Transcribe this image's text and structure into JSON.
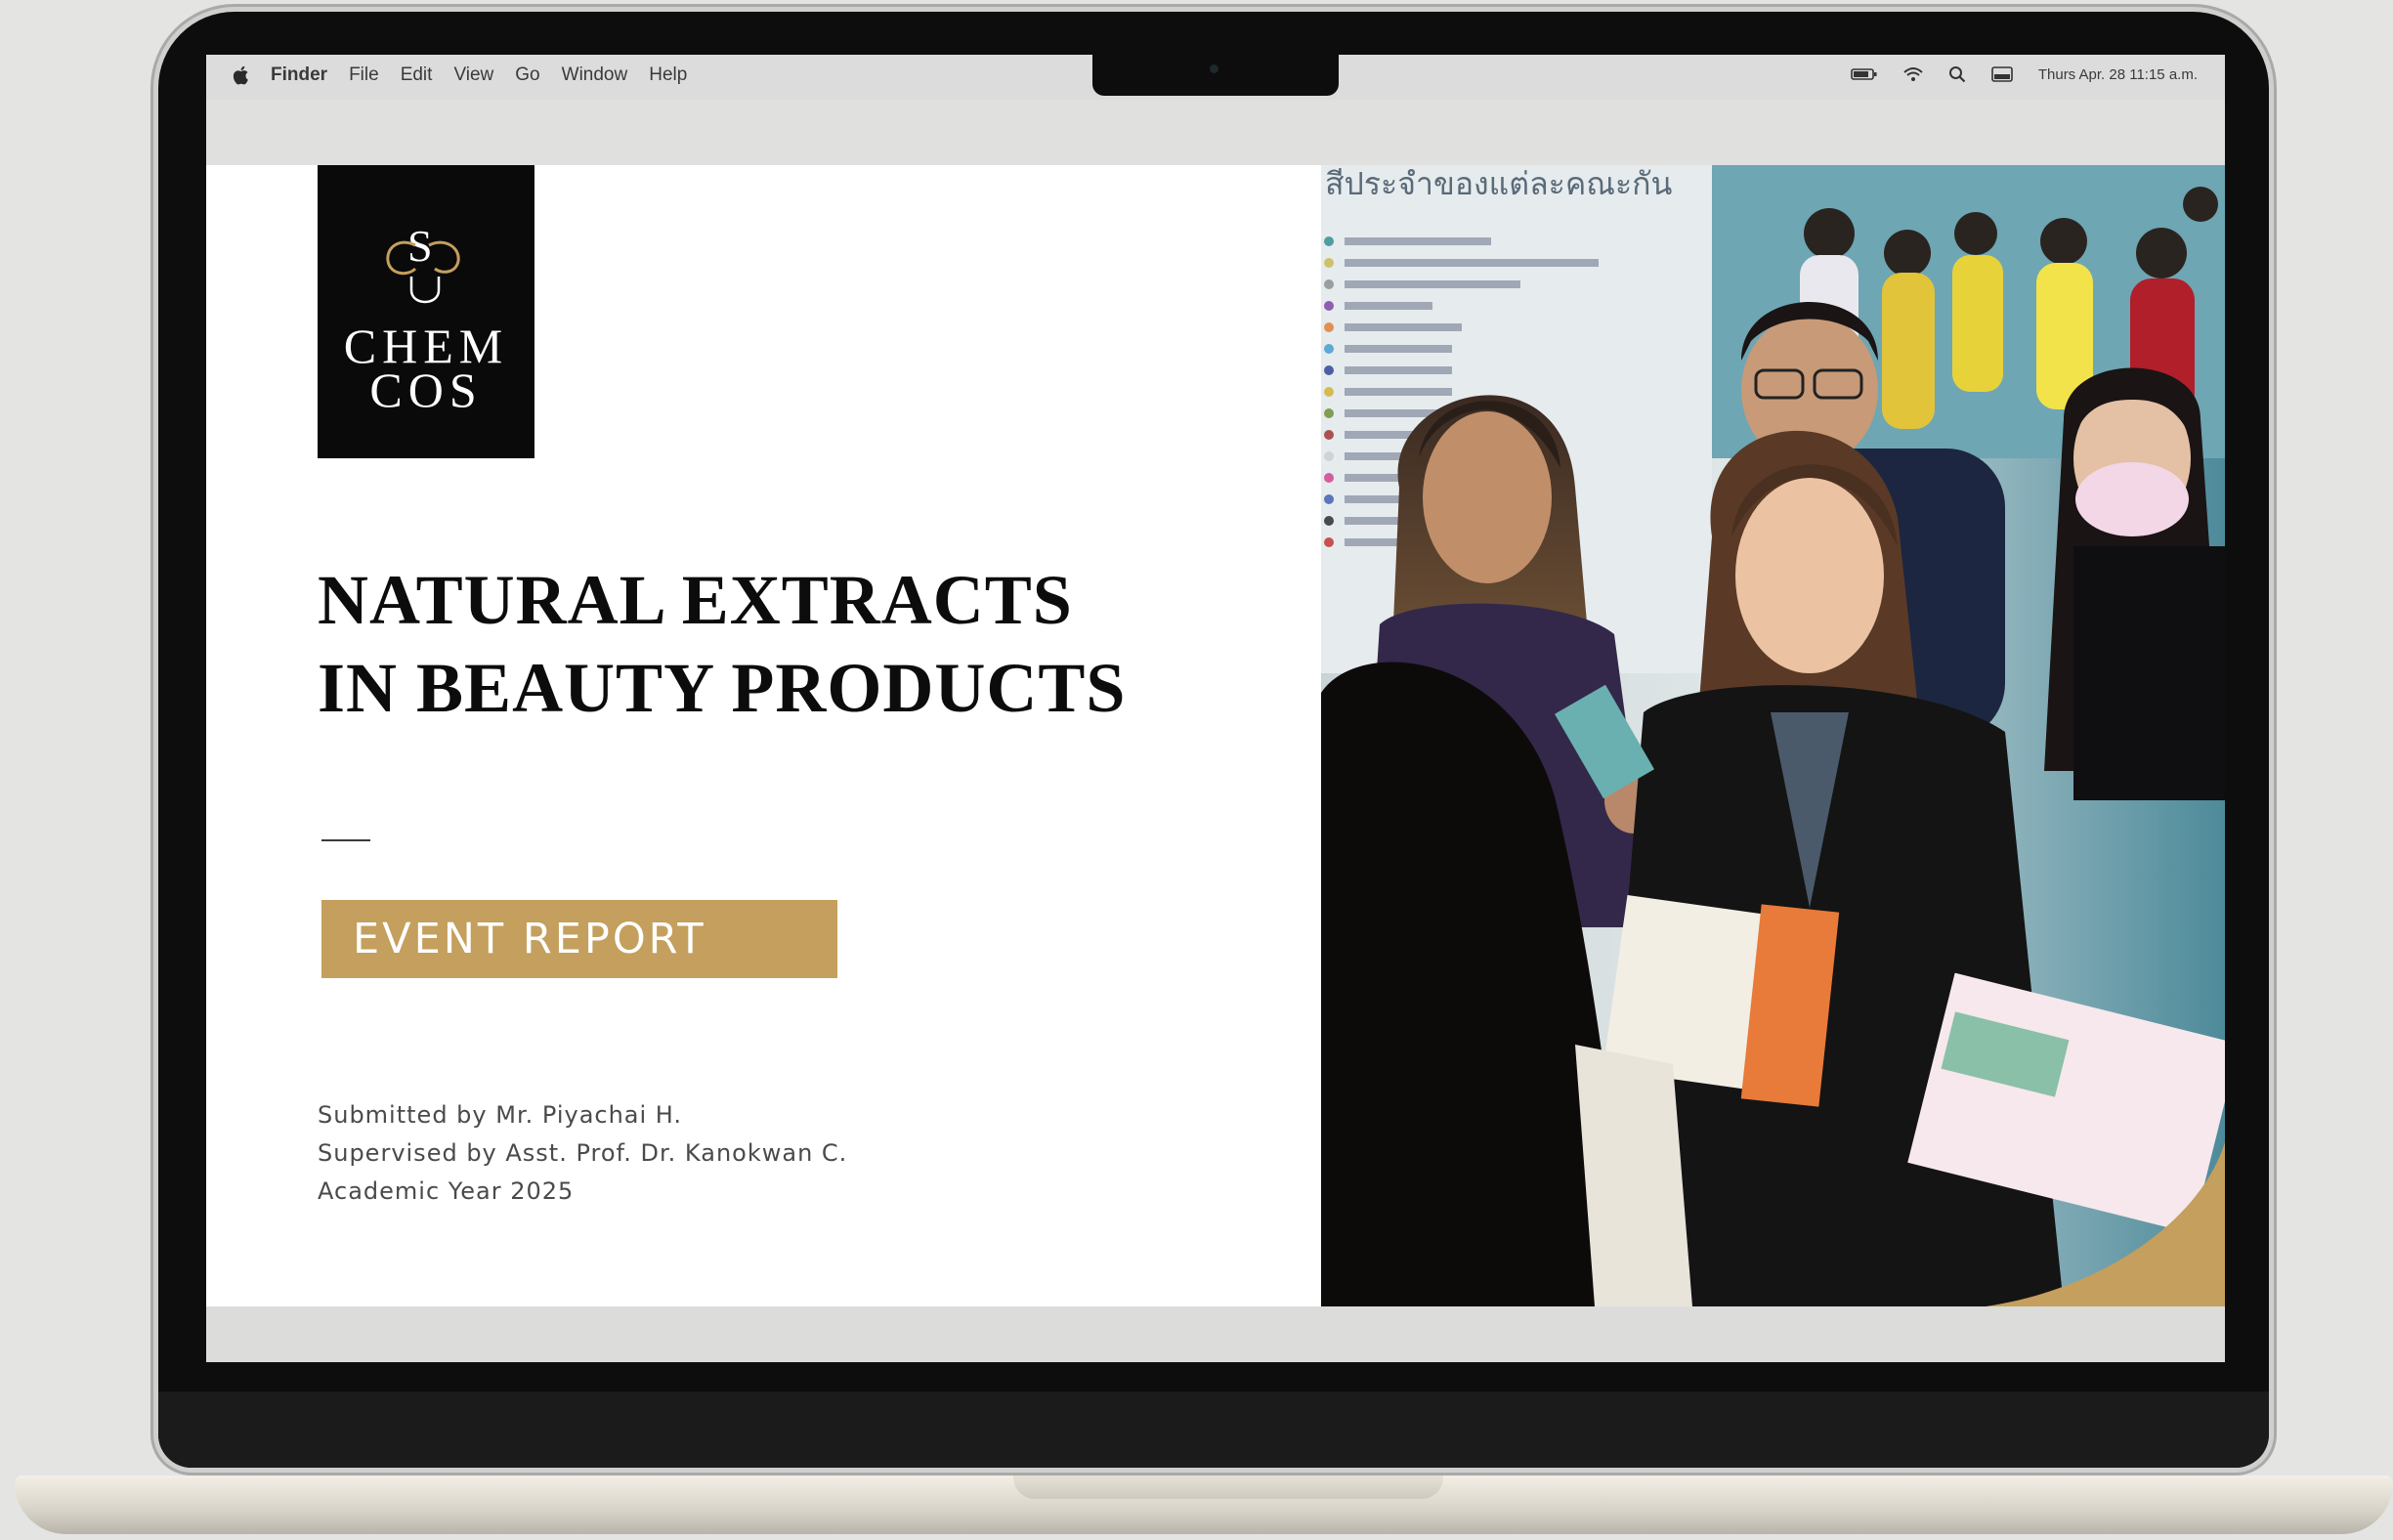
{
  "menubar": {
    "app_name": "Finder",
    "items": [
      "File",
      "Edit",
      "View",
      "Go",
      "Window",
      "Help"
    ],
    "clock": "Thurs Apr. 28  11:15 a.m.",
    "status_icons": [
      "battery-icon",
      "wifi-icon",
      "search-icon",
      "control-center-icon"
    ]
  },
  "slide": {
    "logo": {
      "monogram": "SCG",
      "line1": "CHEM",
      "line2": "COS"
    },
    "title_line1": "NATURAL EXTRACTS",
    "title_line2": "IN BEAUTY PRODUCTS",
    "badge": "EVENT REPORT",
    "credits": {
      "submitted": "Submitted by Mr. Piyachai H.",
      "supervised": "Supervised by Asst. Prof. Dr. Kanokwan C.",
      "year": "Academic Year 2025"
    },
    "photo_sign": "สีประจำของแต่ละคณะกัน"
  },
  "colors": {
    "accent_gold": "#c49f5d",
    "logo_bg": "#0a0a0a",
    "title": "#0c0c0c",
    "bezel": "#0d0d0d"
  }
}
